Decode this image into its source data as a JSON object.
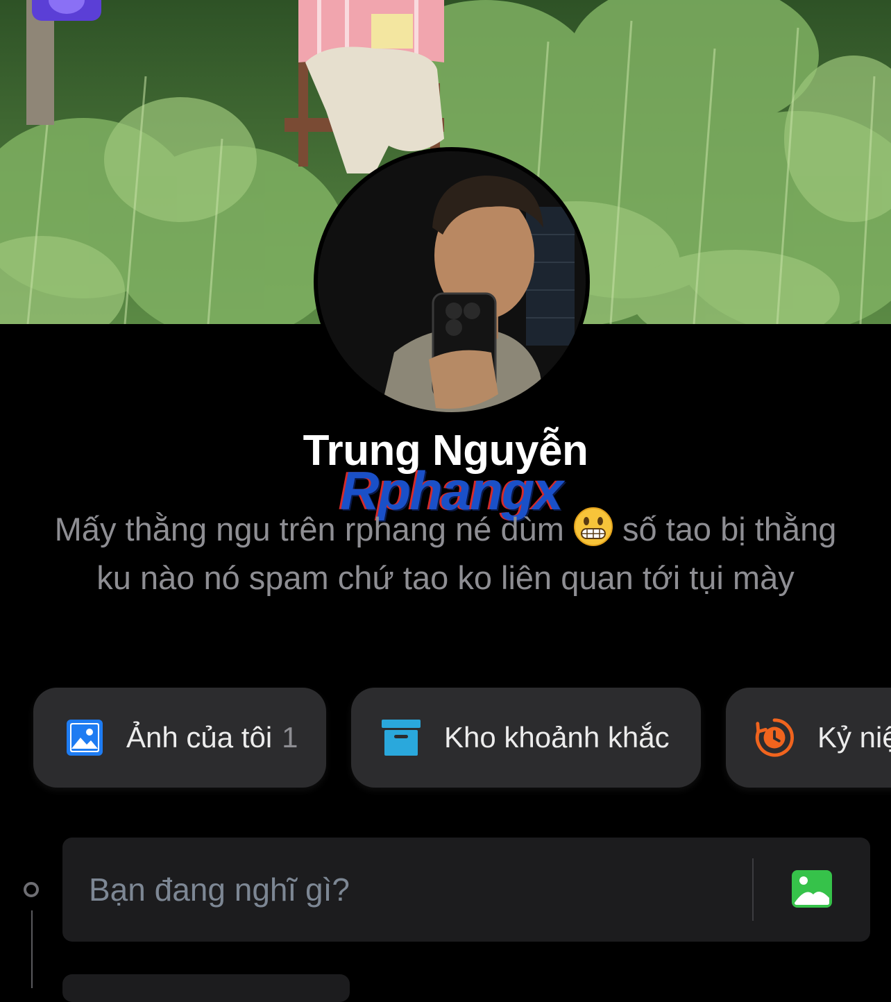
{
  "profile": {
    "name": "Trung Nguyễn",
    "bio_part1": "Mấy thằng ngu trên rphang né dùm ",
    "bio_emoji": "grimacing-face",
    "bio_part2": " số tao bị thằng ku nào nó spam chứ tao ko liên quan tới tụi mày"
  },
  "watermark": "Rphangx",
  "actions": {
    "my_photos": {
      "label": "Ảnh của tôi",
      "count": "1",
      "icon": "image-icon",
      "color": "#1e7cf2"
    },
    "moments": {
      "label": "Kho khoảnh khắc",
      "icon": "archive-box-icon",
      "color": "#2aa8dc"
    },
    "memories": {
      "label": "Kỷ niệ",
      "icon": "clock-history-icon",
      "color": "#f0641e"
    }
  },
  "composer": {
    "placeholder": "Bạn đang nghĩ gì?",
    "photo_icon": "photo-icon",
    "photo_color": "#36c24a"
  },
  "colors": {
    "background": "#000000",
    "card": "#2c2c2e",
    "muted_text": "#8e8e93"
  }
}
